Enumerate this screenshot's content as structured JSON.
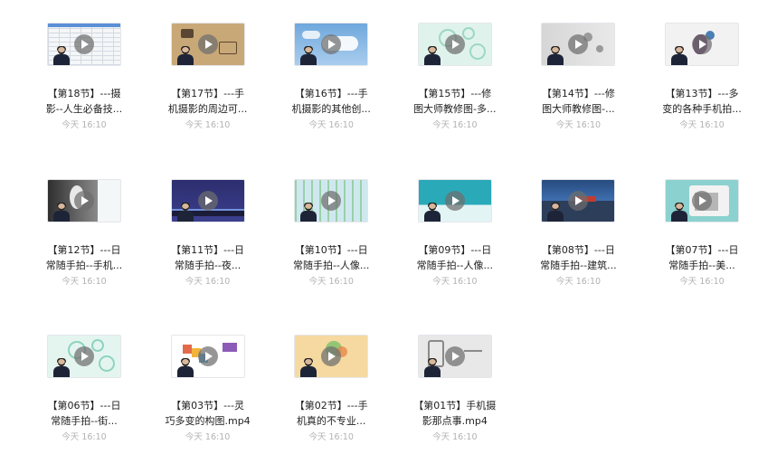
{
  "files": [
    {
      "line1": "【第18节】---摄",
      "line2": "影--人生必备技...",
      "time": "今天 16:10",
      "thumb_bg": "#f4f6f8",
      "accent": "#5b8fd6",
      "thumb_type": "spreadsheet"
    },
    {
      "line1": "【第17节】---手",
      "line2": "机摄影的周边可...",
      "time": "今天 16:10",
      "thumb_bg": "#c9a878",
      "accent": "#5a4632",
      "thumb_type": "desk"
    },
    {
      "line1": "【第16节】---手",
      "line2": "机摄影的其他创...",
      "time": "今天 16:10",
      "thumb_bg": "#6fa8dc",
      "accent": "#ffffff",
      "thumb_type": "sky"
    },
    {
      "line1": "【第15节】---修",
      "line2": "图大师教修图-多...",
      "time": "今天 16:10",
      "thumb_bg": "#dff3ec",
      "accent": "#9fd7c3",
      "thumb_type": "bubbles"
    },
    {
      "line1": "【第14节】---修",
      "line2": "图大师教修图-...",
      "time": "今天 16:10",
      "thumb_bg": "#e9e9e9",
      "accent": "#9a9a9a",
      "thumb_type": "gray"
    },
    {
      "line1": "【第13节】---多",
      "line2": "变的各种手机拍...",
      "time": "今天 16:10",
      "thumb_bg": "#f2f2f2",
      "accent": "#6a3b6b",
      "thumb_type": "splash"
    },
    {
      "line1": "【第12节】---日",
      "line2": "常随手拍--手机...",
      "time": "今天 16:10",
      "thumb_bg": "#f4f7f7",
      "accent": "#3e3e3e",
      "thumb_type": "rabbit"
    },
    {
      "line1": "【第11节】---日",
      "line2": "常随手拍--夜...",
      "time": "今天 16:10",
      "thumb_bg": "#2c2e6e",
      "accent": "#8fb6ff",
      "thumb_type": "night"
    },
    {
      "line1": "【第10节】---日",
      "line2": "常随手拍--人像...",
      "time": "今天 16:10",
      "thumb_bg": "#cfe8ef",
      "accent": "#9ad0a8",
      "thumb_type": "stripes"
    },
    {
      "line1": "【第09节】---日",
      "line2": "常随手拍--人像...",
      "time": "今天 16:10",
      "thumb_bg": "#2aa9b8",
      "accent": "#e3f4f5",
      "thumb_type": "teal"
    },
    {
      "line1": "【第08节】---日",
      "line2": "常随手拍--建筑...",
      "time": "今天 16:10",
      "thumb_bg": "#3f6fb0",
      "accent": "#c33b2f",
      "thumb_type": "harbor"
    },
    {
      "line1": "【第07节】---日",
      "line2": "常随手拍--美...",
      "time": "今天 16:10",
      "thumb_bg": "#8bd1cf",
      "accent": "#7a7a7a",
      "thumb_type": "mint"
    },
    {
      "line1": "【第06节】---日",
      "line2": "常随手拍--街...",
      "time": "今天 16:10",
      "thumb_bg": "#e4f5f0",
      "accent": "#8fd3bf",
      "thumb_type": "bubbles"
    },
    {
      "line1": "【第03节】---灵",
      "line2": "巧多变的构图.mp4",
      "time": "今天 16:10",
      "thumb_bg": "#ffffff",
      "accent": "#e36b4a",
      "thumb_type": "composition"
    },
    {
      "line1": "【第02节】---手",
      "line2": "机真的不专业...",
      "time": "今天 16:10",
      "thumb_bg": "#f5d9a0",
      "accent": "#7bbf6a",
      "thumb_type": "yellow"
    },
    {
      "line1": "【第01节】手机摄",
      "line2": "影那点事.mp4",
      "time": "今天 16:10",
      "thumb_bg": "#e8e8e8",
      "accent": "#8a8a8a",
      "thumb_type": "phone"
    }
  ]
}
